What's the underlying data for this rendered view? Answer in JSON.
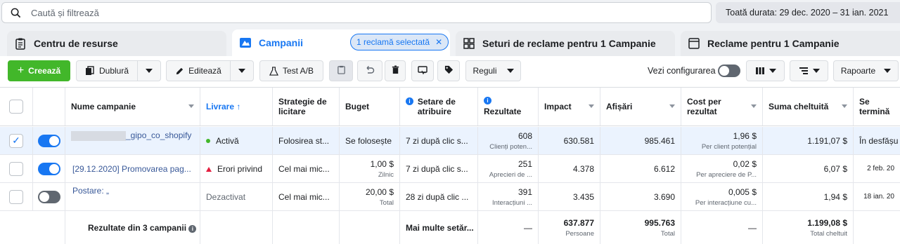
{
  "search": {
    "placeholder": "Caută și filtrează"
  },
  "date_range": "Toată durata: 29 dec. 2020 – 31 ian. 2021",
  "tabs": [
    {
      "label": "Centru de resurse"
    },
    {
      "label": "Campanii"
    },
    {
      "label": "Seturi de reclame pentru 1 Campanie"
    },
    {
      "label": "Reclame pentru 1 Campanie"
    }
  ],
  "selection_pill": "1 reclamă selectată",
  "toolbar": {
    "create": "Creează",
    "duplicate": "Dublură",
    "edit": "Editează",
    "ab_test": "Test A/B",
    "rules": "Reguli",
    "view_config": "Vezi configurarea",
    "reports": "Rapoarte"
  },
  "headers": {
    "name": "Nume campanie",
    "delivery": "Livrare ↑",
    "bid_strategy": "Strategie de licitare",
    "budget": "Buget",
    "attribution": "Setare de atribuire",
    "results": "Rezultate",
    "reach": "Impact",
    "impressions": "Afișări",
    "cost_per_result": "Cost per rezultat",
    "amount_spent": "Suma cheltuită",
    "ends": "Se termină"
  },
  "rows": [
    {
      "name": "_gipo_co_shopify",
      "delivery": "Activă",
      "bid_strategy": "Folosirea st...",
      "budget": "Se folosește",
      "budget_sub": "",
      "attribution": "7 zi după clic s...",
      "results": "608",
      "results_sub": "Clienți poten...",
      "reach": "630.581",
      "impressions": "985.461",
      "cost": "1,96 $",
      "cost_sub": "Per client potențial",
      "spent": "1.191,07 $",
      "ends": "În desfășu"
    },
    {
      "name": "[29.12.2020] Promovarea pag...",
      "delivery": "Erori privind",
      "bid_strategy": "Cel mai mic...",
      "budget": "1,00 $",
      "budget_sub": "Zilnic",
      "attribution": "7 zi după clic s...",
      "results": "251",
      "results_sub": "Aprecieri de ...",
      "reach": "4.378",
      "impressions": "6.612",
      "cost": "0,02 $",
      "cost_sub": "Per apreciere de P...",
      "spent": "6,07 $",
      "ends": "2 feb. 20"
    },
    {
      "name": "Postare: „",
      "delivery": "Dezactivat",
      "bid_strategy": "Cel mai mic...",
      "budget": "20,00 $",
      "budget_sub": "Total",
      "attribution": "28 zi după clic ...",
      "results": "391",
      "results_sub": "Interacțiuni ...",
      "reach": "3.435",
      "impressions": "3.690",
      "cost": "0,005 $",
      "cost_sub": "Per interacțiune cu...",
      "spent": "1,94 $",
      "ends": "18 ian. 20"
    }
  ],
  "totals": {
    "label": "Rezultate din 3 campanii",
    "attribution": "Mai multe setăr...",
    "results": "—",
    "reach": "637.877",
    "reach_sub": "Persoane",
    "impressions": "995.763",
    "impressions_sub": "Total",
    "cost": "—",
    "spent": "1.199,08 $",
    "spent_sub": "Total cheltuit"
  },
  "colors": {
    "accent": "#1877f2",
    "create_green": "#42b72a",
    "active_dot": "#42b72a",
    "error": "#e41e3f"
  }
}
